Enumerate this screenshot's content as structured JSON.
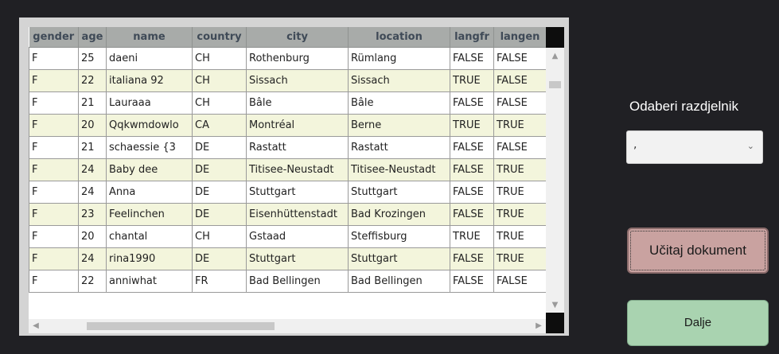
{
  "grid": {
    "columns": [
      "gender",
      "age",
      "name",
      "country",
      "city",
      "location",
      "langfr",
      "langen"
    ],
    "rows": [
      [
        "F",
        "25",
        "daeni",
        "CH",
        "Rothenburg",
        "Rümlang",
        "FALSE",
        "FALSE"
      ],
      [
        "F",
        "22",
        "italiana 92",
        "CH",
        "Sissach",
        "Sissach",
        "TRUE",
        "FALSE"
      ],
      [
        "F",
        "21",
        "Lauraaa",
        "CH",
        "Bâle",
        "Bâle",
        "FALSE",
        "FALSE"
      ],
      [
        "F",
        "20",
        "Qqkwmdowlo",
        "CA",
        "Montréal",
        "Berne",
        "TRUE",
        "TRUE"
      ],
      [
        "F",
        "21",
        "schaessie {3",
        "DE",
        "Rastatt",
        "Rastatt",
        "FALSE",
        "FALSE"
      ],
      [
        "F",
        "24",
        "Baby dee",
        "DE",
        "Titisee-Neustadt",
        "Titisee-Neustadt",
        "FALSE",
        "TRUE"
      ],
      [
        "F",
        "24",
        "Anna",
        "DE",
        "Stuttgart",
        "Stuttgart",
        "FALSE",
        "TRUE"
      ],
      [
        "F",
        "23",
        "Feelinchen",
        "DE",
        "Eisenhüttenstadt",
        "Bad Krozingen",
        "FALSE",
        "TRUE"
      ],
      [
        "F",
        "20",
        "chantal",
        "CH",
        "Gstaad",
        "Steffisburg",
        "TRUE",
        "TRUE"
      ],
      [
        "F",
        "24",
        "rina1990",
        "DE",
        "Stuttgart",
        "Stuttgart",
        "FALSE",
        "TRUE"
      ],
      [
        "F",
        "22",
        "anniwhat",
        "FR",
        "Bad Bellingen",
        "Bad Bellingen",
        "FALSE",
        "FALSE"
      ]
    ]
  },
  "separator": {
    "label": "Odaberi razdjelnik",
    "selected": ","
  },
  "buttons": {
    "load_label": "Učitaj dokument",
    "next_label": "Dalje"
  },
  "icons": {
    "scroll_up": "chevron-up-icon",
    "scroll_down": "chevron-down-icon",
    "scroll_left": "chevron-left-icon",
    "scroll_right": "chevron-right-icon",
    "dropdown": "chevron-down-icon"
  },
  "colors": {
    "header_bg": "#a8aba9",
    "row_alt_bg": "#f3f5dc",
    "load_button_bg": "#c9a2a0",
    "next_button_bg": "#a9d3b0",
    "window_bg": "#202024"
  }
}
